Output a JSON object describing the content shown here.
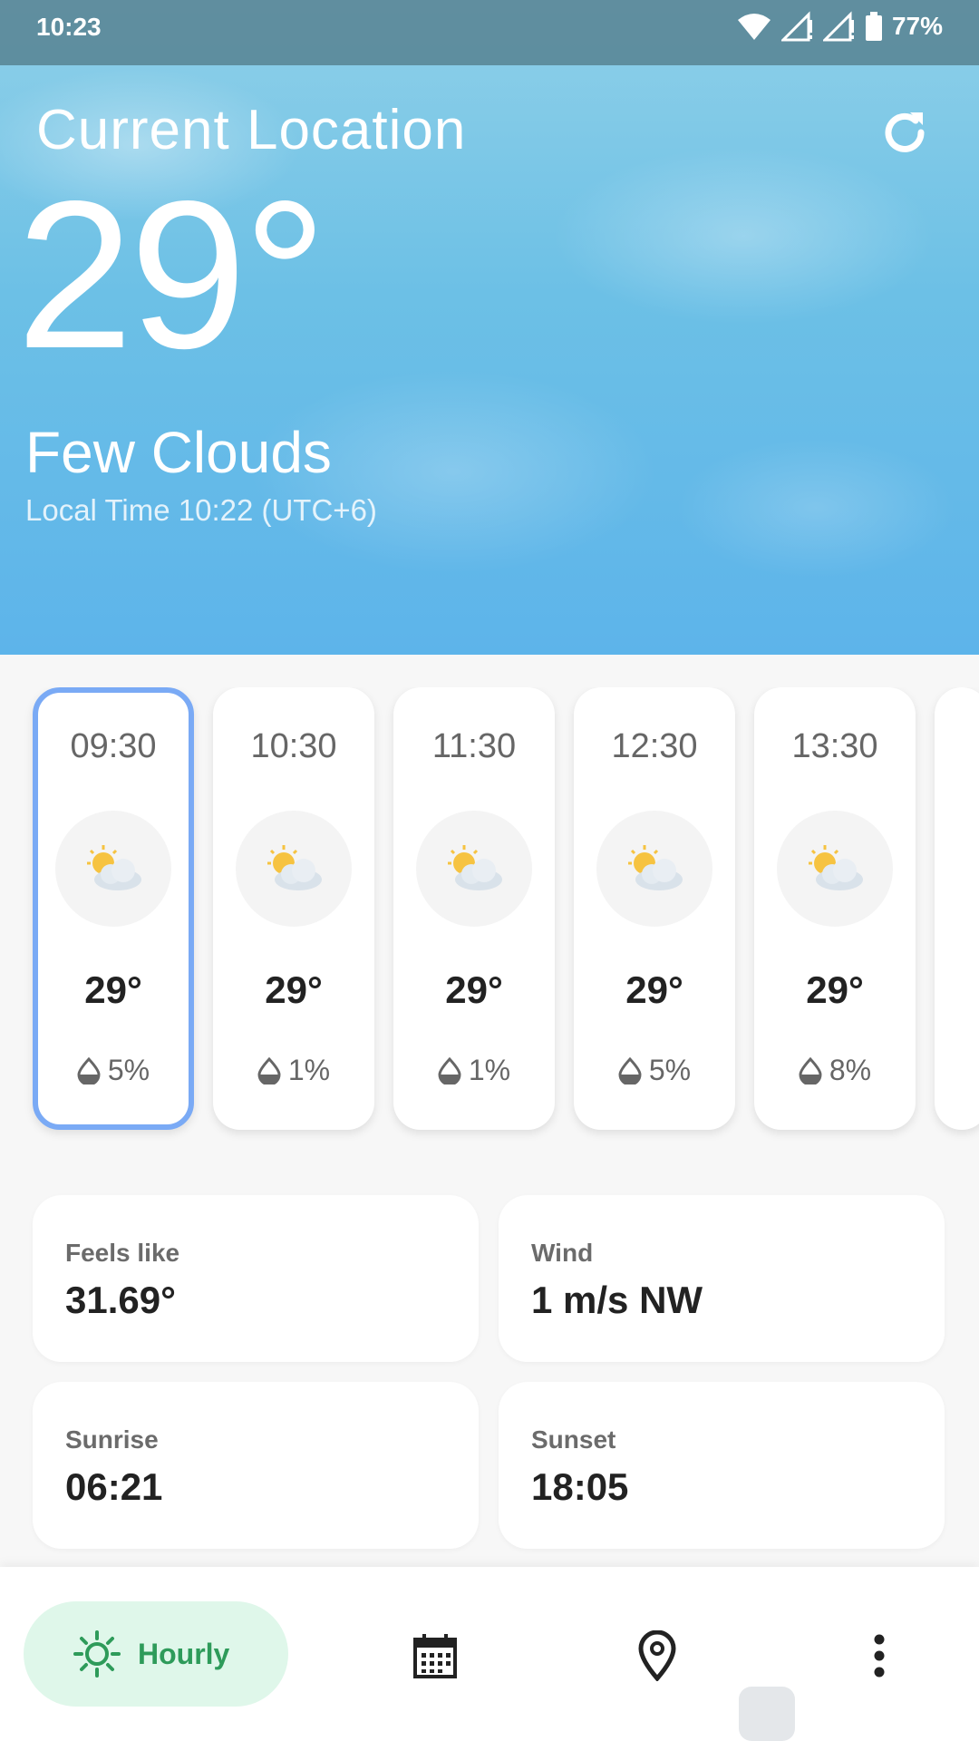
{
  "status_bar": {
    "time": "10:23",
    "battery": "77%"
  },
  "header": {
    "location": "Current Location",
    "temperature": "29°",
    "condition": "Few Clouds",
    "local_time": "Local Time 10:22 (UTC+6)"
  },
  "hourly": [
    {
      "time": "09:30",
      "temp": "29°",
      "precip": "5%",
      "icon": "sun-behind-cloud-icon",
      "selected": true
    },
    {
      "time": "10:30",
      "temp": "29°",
      "precip": "1%",
      "icon": "sun-behind-cloud-icon"
    },
    {
      "time": "11:30",
      "temp": "29°",
      "precip": "1%",
      "icon": "sun-behind-cloud-icon"
    },
    {
      "time": "12:30",
      "temp": "29°",
      "precip": "5%",
      "icon": "sun-behind-cloud-icon"
    },
    {
      "time": "13:30",
      "temp": "29°",
      "precip": "8%",
      "icon": "sun-behind-cloud-icon"
    }
  ],
  "details": {
    "feels_like": {
      "label": "Feels like",
      "value": "31.69°"
    },
    "wind": {
      "label": "Wind",
      "value": "1 m/s NW"
    },
    "sunrise": {
      "label": "Sunrise",
      "value": "06:21"
    },
    "sunset": {
      "label": "Sunset",
      "value": "18:05"
    }
  },
  "nav": {
    "hourly_label": "Hourly",
    "items": [
      "sun-icon",
      "calendar-icon",
      "location-pin-icon",
      "more-vert-icon"
    ]
  },
  "colors": {
    "selected_border": "#7aaaf5",
    "nav_active_bg": "#dff7ea",
    "nav_active_fg": "#2e9b5a"
  }
}
